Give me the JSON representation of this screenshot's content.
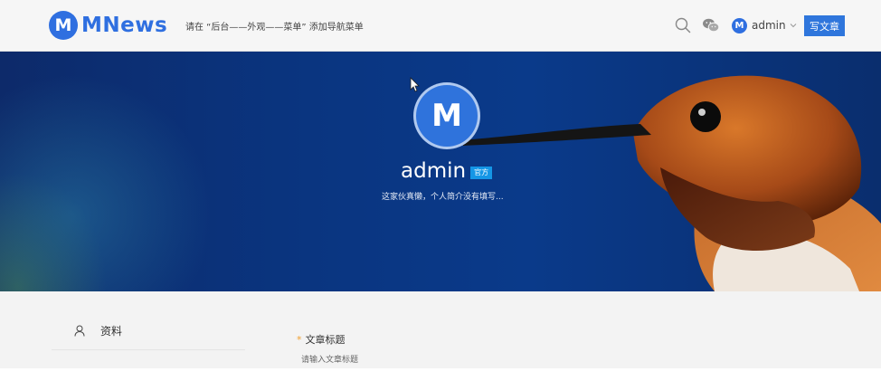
{
  "header": {
    "logo_letter": "M",
    "logo_text": "MNews",
    "nav_hint": "请在 “后台——外观——菜单” 添加导航菜单",
    "user_avatar_letter": "M",
    "user_name": "admin",
    "write_button": "写文章",
    "icons": [
      "search-icon",
      "wechat-icon",
      "chevron-down-icon"
    ]
  },
  "profile": {
    "avatar_letter": "M",
    "name": "admin",
    "badge": "官方",
    "bio": "这家伙真懒，个人简介没有填写..."
  },
  "sidebar": {
    "items": [
      {
        "label": "资料",
        "icon": "user-icon"
      }
    ]
  },
  "form": {
    "title_label": "文章标题",
    "required_mark": "*",
    "title_placeholder": "请输入文章标题"
  },
  "colors": {
    "brand": "#2f6fe0",
    "button": "#2f76dc",
    "badge": "#1596e6",
    "required": "#f0a030"
  }
}
